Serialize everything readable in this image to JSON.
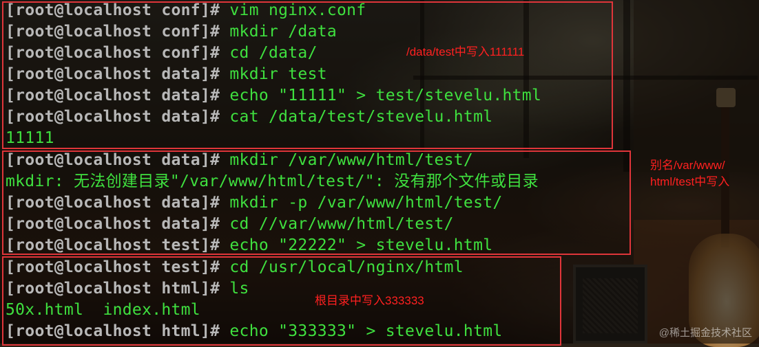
{
  "terminal": {
    "lines": [
      {
        "prompt": "[root@localhost conf]#",
        "cmd": " vim nginx.conf"
      },
      {
        "prompt": "[root@localhost conf]#",
        "cmd": " mkdir /data"
      },
      {
        "prompt": "[root@localhost conf]#",
        "cmd": " cd /data/"
      },
      {
        "prompt": "[root@localhost data]#",
        "cmd": " mkdir test"
      },
      {
        "prompt": "[root@localhost data]#",
        "cmd": " echo \"11111\" > test/stevelu.html"
      },
      {
        "prompt": "[root@localhost data]#",
        "cmd": " cat /data/test/stevelu.html"
      },
      {
        "output": "11111"
      },
      {
        "prompt": "[root@localhost data]#",
        "cmd": " mkdir /var/www/html/test/"
      },
      {
        "output": "mkdir: 无法创建目录\"/var/www/html/test/\": 没有那个文件或目录"
      },
      {
        "prompt": "[root@localhost data]#",
        "cmd": " mkdir -p /var/www/html/test/"
      },
      {
        "prompt": "[root@localhost data]#",
        "cmd": " cd //var/www/html/test/"
      },
      {
        "prompt": "[root@localhost test]#",
        "cmd": " echo \"22222\" > stevelu.html"
      },
      {
        "prompt": "[root@localhost test]#",
        "cmd": " cd /usr/local/nginx/html"
      },
      {
        "prompt": "[root@localhost html]#",
        "cmd": " ls"
      },
      {
        "output": "50x.html  index.html"
      },
      {
        "prompt": "[root@localhost html]#",
        "cmd": " echo \"333333\" > stevelu.html"
      }
    ]
  },
  "annotations": {
    "note1": "/data/test中写入111111",
    "note2": "别名/var/www/\nhtml/test中写入",
    "note3": "根目录中写入333333",
    "box_color": "#e0353a",
    "text_color": "#ff2020"
  },
  "watermark": "@稀土掘金技术社区"
}
